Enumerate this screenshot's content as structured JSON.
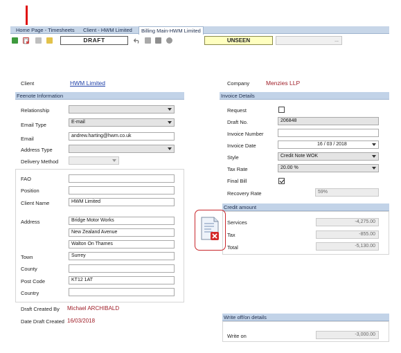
{
  "tabs": [
    {
      "label": "Home Page - Timesheets",
      "active": false
    },
    {
      "label": "Client - HWM Limited",
      "active": false
    },
    {
      "label": "Billing Main-HWM Limited",
      "active": true
    }
  ],
  "toolbar": {
    "status_label": "DRAFT",
    "seen_label": "UNSEEN",
    "more_label": "..."
  },
  "client": {
    "label": "Client",
    "value": "HWM Limited"
  },
  "company": {
    "label": "Company",
    "value": "Menzies LLP"
  },
  "feenote": {
    "header": "Feenote Information",
    "relationship_label": "Relationship",
    "relationship_value": "",
    "email_type_label": "Email Type",
    "email_type_value": "E-mail",
    "email_label": "Email",
    "email_value": "andrew.harting@hwm.co.uk",
    "address_type_label": "Address Type",
    "address_type_value": "",
    "delivery_method_label": "Delivery Method",
    "delivery_method_value": ""
  },
  "address_block": {
    "fao_label": "FAO",
    "fao_value": "",
    "position_label": "Position",
    "position_value": "",
    "client_name_label": "Client Name",
    "client_name_value": "HWM Limited",
    "address_label": "Address",
    "address_lines": [
      "Bridge Motor Works",
      "New Zealand Avenue",
      "Walton On Thames"
    ],
    "town_label": "Town",
    "town_value": "Surrey",
    "county_label": "County",
    "county_value": "",
    "post_code_label": "Post Code",
    "post_code_value": "KT12 1AT",
    "country_label": "Country",
    "country_value": ""
  },
  "draft_info": {
    "created_by_label": "Draft Created By",
    "created_by_value": "Michael ARCHIBALD",
    "created_date_label": "Date Draft Created",
    "created_date_value": "16/03/2018"
  },
  "invoice": {
    "header": "Invoice Details",
    "request_label": "Request",
    "request_checked": false,
    "draft_no_label": "Draft No.",
    "draft_no_value": "206848",
    "invoice_number_label": "Invoice Number",
    "invoice_number_value": "",
    "invoice_date_label": "Invoice Date",
    "invoice_date_value": "16 / 03 / 2018",
    "style_label": "Style",
    "style_value": "Credit Note WOK",
    "tax_rate_label": "Tax Rate",
    "tax_rate_value": "20.00 %",
    "final_bill_label": "Final Bill",
    "final_bill_checked": true,
    "recovery_rate_label": "Recovery Rate",
    "recovery_rate_value": "59%"
  },
  "credit": {
    "header": "Credit amount",
    "services_label": "Services",
    "services_value": "-4,275.00",
    "tax_label": "Tax",
    "tax_value": "-855.00",
    "total_label": "Total",
    "total_value": "-5,130.00"
  },
  "writeoff": {
    "header": "Write off/on details",
    "write_on_label": "Write on",
    "write_on_value": "-3,000.00"
  },
  "colors": {
    "accent_red": "#c8252a",
    "header_blue": "#c2d3e8",
    "link_blue": "#1d3fa8",
    "unseen_yellow": "#ffffc0"
  }
}
